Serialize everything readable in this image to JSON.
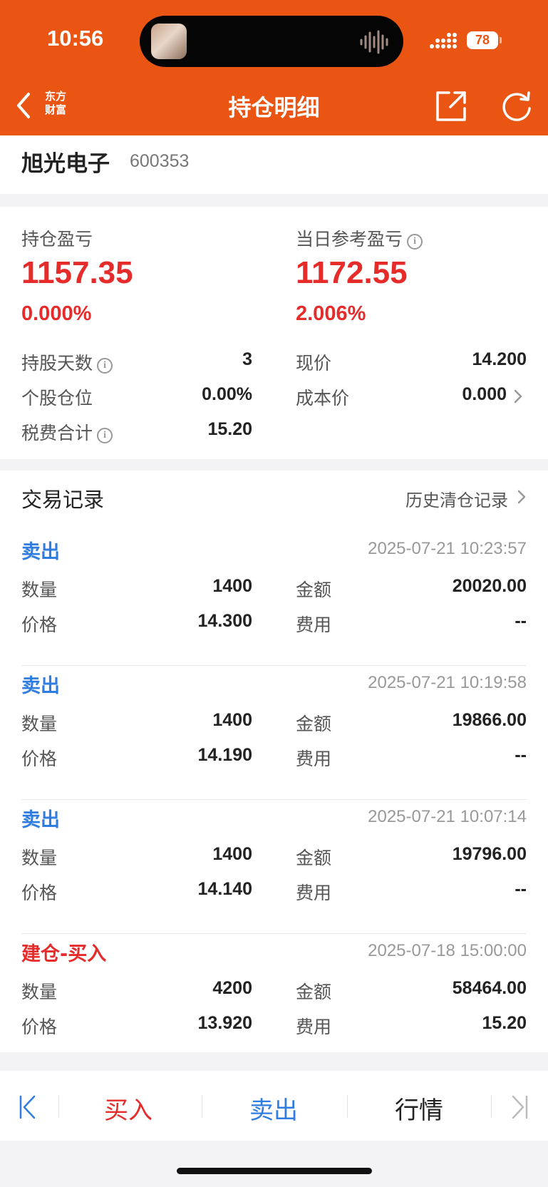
{
  "status_bar": {
    "time": "10:56",
    "battery": "78"
  },
  "nav": {
    "title": "持仓明细",
    "brand_line1": "东方",
    "brand_line2": "财富",
    "back_icon": "chevron-left-icon",
    "share_icon": "share-icon",
    "refresh_icon": "refresh-icon"
  },
  "stock": {
    "name": "旭光电子",
    "code": "600353"
  },
  "summary": {
    "position_pnl_label": "持仓盈亏",
    "position_pnl": "1157.35",
    "position_pnl_pct": "0.000%",
    "daily_pnl_label": "当日参考盈亏",
    "daily_pnl": "1172.55",
    "daily_pnl_pct": "2.006%",
    "rows": {
      "hold_days_label": "持股天数",
      "hold_days": "3",
      "position_ratio_label": "个股仓位",
      "position_ratio": "0.00%",
      "tax_label": "税费合计",
      "tax": "15.20",
      "current_price_label": "现价",
      "current_price": "14.200",
      "cost_price_label": "成本价",
      "cost_price": "0.000"
    }
  },
  "trades_section": {
    "title": "交易记录",
    "history_link": "历史清仓记录",
    "labels": {
      "qty": "数量",
      "price": "价格",
      "amount": "金额",
      "fee": "费用"
    },
    "trades": [
      {
        "type": "卖出",
        "time": "2025-07-21 10:23:57",
        "qty": "1400",
        "price": "14.300",
        "amount": "20020.00",
        "fee": "--"
      },
      {
        "type": "卖出",
        "time": "2025-07-21 10:19:58",
        "qty": "1400",
        "price": "14.190",
        "amount": "19866.00",
        "fee": "--"
      },
      {
        "type": "卖出",
        "time": "2025-07-21 10:07:14",
        "qty": "1400",
        "price": "14.140",
        "amount": "19796.00",
        "fee": "--"
      },
      {
        "type": "建仓-买入",
        "time": "2025-07-18 15:00:00",
        "qty": "4200",
        "price": "13.920",
        "amount": "58464.00",
        "fee": "15.20"
      }
    ]
  },
  "bottom_bar": {
    "buy": "买入",
    "sell": "卖出",
    "market": "行情"
  },
  "colors": {
    "brand": "#ea5514",
    "up_red": "#e62b2b",
    "sell_blue": "#2f7de1"
  }
}
